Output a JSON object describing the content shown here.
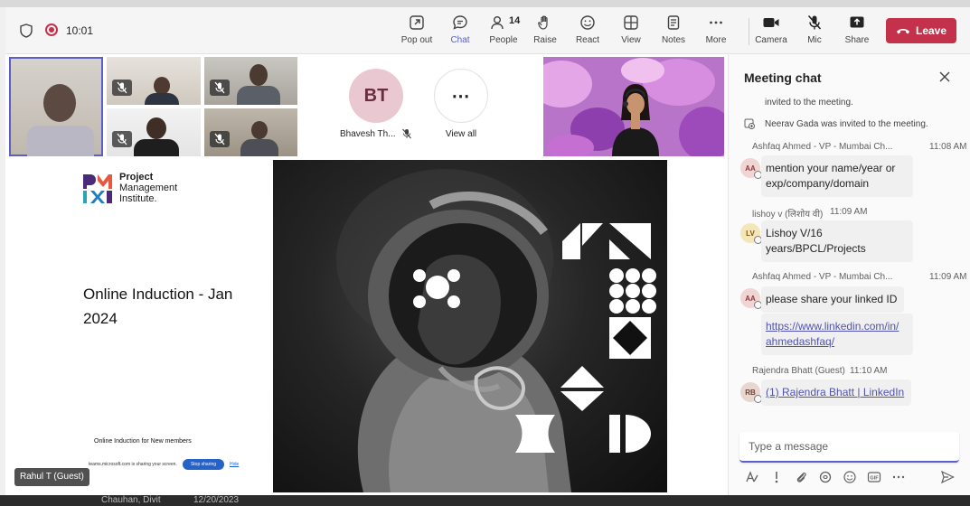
{
  "topbar": {
    "time": "10:01",
    "people_count": "14",
    "buttons": {
      "popout": "Pop out",
      "chat": "Chat",
      "people": "People",
      "raise": "Raise",
      "react": "React",
      "view": "View",
      "notes": "Notes",
      "more": "More",
      "camera": "Camera",
      "mic": "Mic",
      "share": "Share"
    },
    "leave_label": "Leave"
  },
  "gallery": {
    "avatar_initials": "BT",
    "avatar_name": "Bhavesh Th...",
    "view_all_label": "View all",
    "view_all_glyph": "⋯"
  },
  "slide": {
    "org_line1": "Project",
    "org_line2": "Management",
    "org_line3": "Institute.",
    "title": "Online Induction - Jan 2024",
    "subtitle": "Online Induction for New members",
    "share_banner_msg": "teams.microsoft.com is sharing your screen.",
    "share_banner_stop": "Stop sharing",
    "share_banner_hide": "Hide"
  },
  "stage": {
    "name_tag": "Rahul T (Guest)"
  },
  "chat": {
    "title": "Meeting chat",
    "system_messages": [
      "invited to the meeting.",
      "Neerav Gada was invited to the meeting."
    ],
    "messages": [
      {
        "sender": "Ashfaq Ahmed - VP - Mumbai Ch...",
        "time": "11:08 AM",
        "initials": "AA",
        "lines": [
          "mention your name/year or",
          "exp/company/domain"
        ]
      },
      {
        "sender": "lishoy v (लिशोय वी)",
        "time": "11:09 AM",
        "initials": "LV",
        "lines": [
          "Lishoy V/16",
          "years/BPCL/Projects"
        ]
      },
      {
        "sender": "Ashfaq Ahmed - VP - Mumbai Ch...",
        "time": "11:09 AM",
        "initials": "AA",
        "lines": [
          "please share your linked ID"
        ],
        "link_lines": [
          "https://www.linkedin.com/in/",
          "ahmedashfaq/"
        ]
      },
      {
        "sender": "Rajendra Bhatt (Guest)",
        "time": "11:10 AM",
        "initials": "RB",
        "link": "(1) Rajendra Bhatt | LinkedIn"
      }
    ],
    "compose_placeholder": "Type a message"
  },
  "taskbar": {
    "name": "Chauhan, Divit",
    "date": "12/20/2023"
  },
  "colors": {
    "accent": "#5b5fc7",
    "leave": "#c4314b",
    "avatar_bt_bg": "#e9c8d2",
    "avatar_aa_bg": "#f1d4d4",
    "avatar_lv_bg": "#f4e6b8",
    "avatar_rb_bg": "#e8d6cf"
  }
}
